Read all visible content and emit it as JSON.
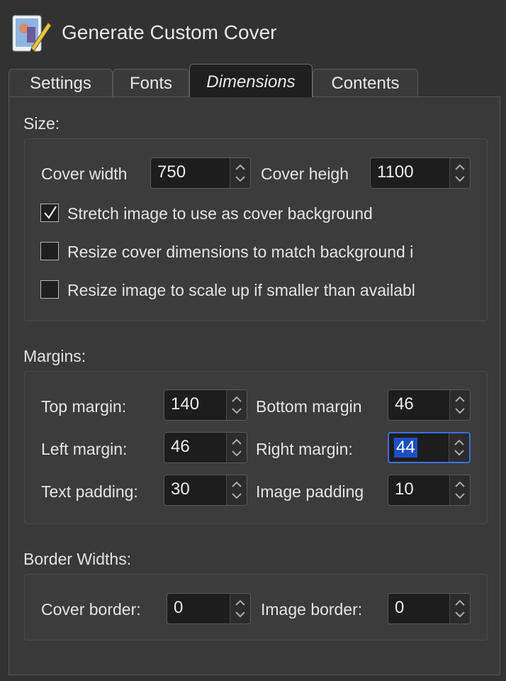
{
  "window": {
    "title": "Generate Custom Cover",
    "icon": "cover-editor-icon"
  },
  "tabs": [
    {
      "label": "Settings",
      "active": false
    },
    {
      "label": "Fonts",
      "active": false
    },
    {
      "label": "Dimensions",
      "active": true
    },
    {
      "label": "Contents",
      "active": false
    }
  ],
  "size": {
    "section_label": "Size:",
    "cover_width_label": "Cover width",
    "cover_width_value": "750",
    "cover_height_label": "Cover heigh",
    "cover_height_value": "1100",
    "stretch_label": "Stretch image to use as cover background",
    "stretch_checked": true,
    "resize_dims_label": "Resize cover dimensions to match background i",
    "resize_dims_checked": false,
    "resize_scale_label": "Resize image to scale up if smaller than availabl",
    "resize_scale_checked": false
  },
  "margins": {
    "section_label": "Margins:",
    "top_label": "Top margin:",
    "top_value": "140",
    "bottom_label": "Bottom margin",
    "bottom_value": "46",
    "left_label": "Left margin:",
    "left_value": "46",
    "right_label": "Right margin:",
    "right_value": "44",
    "text_padding_label": "Text padding:",
    "text_padding_value": "30",
    "image_padding_label": "Image padding",
    "image_padding_value": "10"
  },
  "borders": {
    "section_label": "Border Widths:",
    "cover_border_label": "Cover border:",
    "cover_border_value": "0",
    "image_border_label": "Image border:",
    "image_border_value": "0"
  }
}
